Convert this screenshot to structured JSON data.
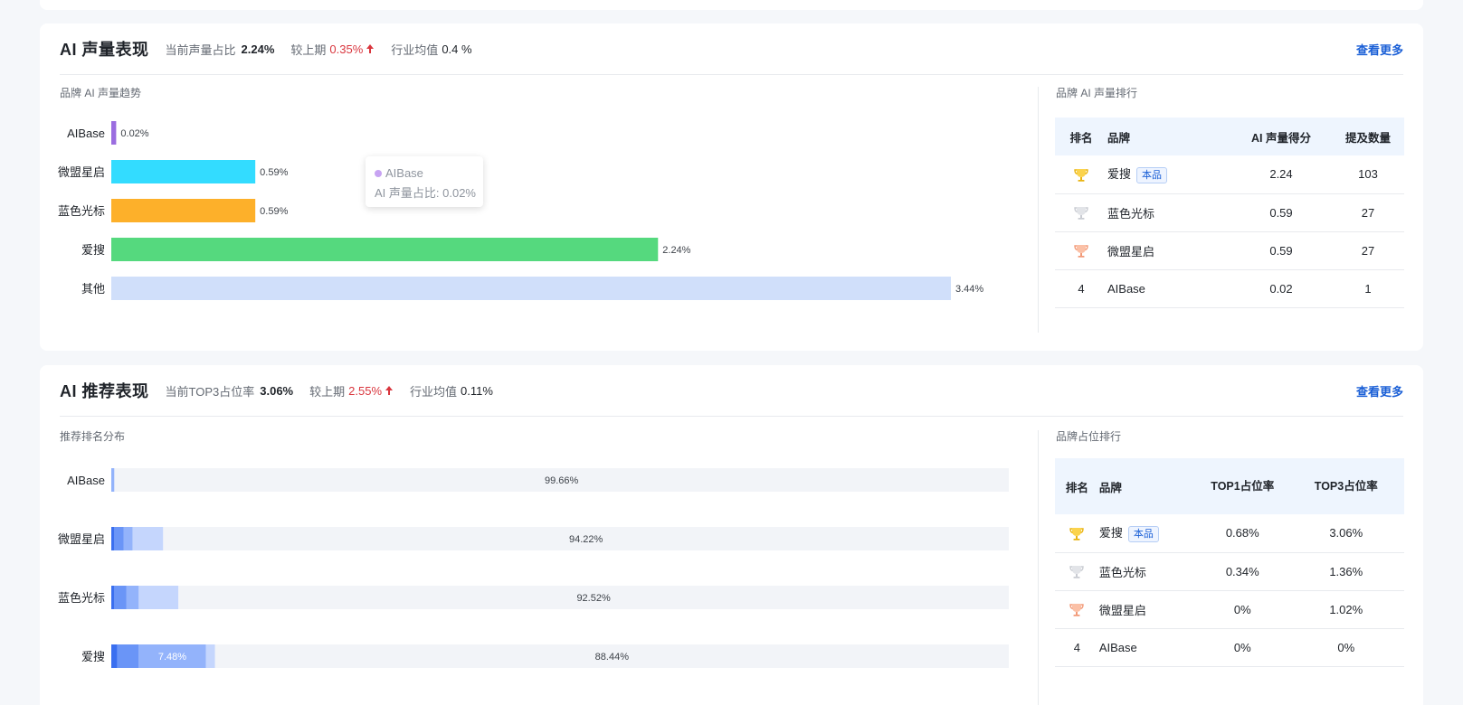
{
  "voice": {
    "title": "AI 声量表现",
    "metric1_label": "当前声量占比",
    "metric1_value": "2.24%",
    "metric2_label": "较上期",
    "metric2_value": "0.35%",
    "metric3_label": "行业均值",
    "metric3_value": "0.4 %",
    "more": "查看更多",
    "trend_label": "品牌 AI 声量趋势",
    "rank_label": "品牌 AI 声量排行",
    "tooltip_name": "AIBase",
    "tooltip_value": "AI 声量占比: 0.02%",
    "table": {
      "headers": [
        "排名",
        "品牌",
        "AI 声量得分",
        "提及数量"
      ],
      "rows": [
        {
          "rank": "trophy-gold",
          "brand": "爱搜",
          "tag": "本品",
          "score": "2.24",
          "count": "103"
        },
        {
          "rank": "trophy-silver",
          "brand": "蓝色光标",
          "tag": "",
          "score": "0.59",
          "count": "27"
        },
        {
          "rank": "trophy-bronze",
          "brand": "微盟星启",
          "tag": "",
          "score": "0.59",
          "count": "27"
        },
        {
          "rank": "4",
          "brand": "AIBase",
          "tag": "",
          "score": "0.02",
          "count": "1"
        }
      ]
    }
  },
  "recommend": {
    "title": "AI 推荐表现",
    "metric1_label": "当前TOP3占位率",
    "metric1_value": "3.06%",
    "metric2_label": "较上期",
    "metric2_value": "2.55%",
    "metric3_label": "行业均值",
    "metric3_value": "0.11%",
    "more": "查看更多",
    "dist_label": "推荐排名分布",
    "rank_label": "品牌占位排行",
    "table": {
      "headers": [
        "排名",
        "品牌",
        "TOP1占位率",
        "TOP3占位率"
      ],
      "rows": [
        {
          "rank": "trophy-gold",
          "brand": "爱搜",
          "tag": "本品",
          "top1": "0.68%",
          "top3": "3.06%"
        },
        {
          "rank": "trophy-silver",
          "brand": "蓝色光标",
          "tag": "",
          "top1": "0.34%",
          "top3": "1.36%"
        },
        {
          "rank": "trophy-bronze",
          "brand": "微盟星启",
          "tag": "",
          "top1": "0%",
          "top3": "1.02%"
        },
        {
          "rank": "4",
          "brand": "AIBase",
          "tag": "",
          "top1": "0%",
          "top3": "0%"
        }
      ]
    }
  },
  "chart_data": [
    {
      "type": "bar",
      "orientation": "horizontal",
      "categories": [
        "AIBase",
        "微盟星启",
        "蓝色光标",
        "爱搜",
        "其他"
      ],
      "values": [
        0.02,
        0.59,
        0.59,
        2.24,
        3.44
      ],
      "value_labels": [
        "0.02%",
        "0.59%",
        "0.59%",
        "2.24%",
        "3.44%"
      ],
      "colors": [
        "#9b6de0",
        "#33dcff",
        "#fdb02a",
        "#55d97e",
        "#d0dffa"
      ],
      "xlim": [
        0,
        3.44
      ]
    },
    {
      "type": "bar",
      "orientation": "horizontal",
      "stacked": true,
      "categories": [
        "AIBase",
        "微盟星启",
        "蓝色光标",
        "爱搜"
      ],
      "series": [
        {
          "values": [
            0,
            0.34,
            0.34,
            0.68
          ],
          "color": "#3a6ff0"
        },
        {
          "values": [
            0,
            1.02,
            1.36,
            2.38
          ],
          "color": "#6a95f7"
        },
        {
          "values": [
            0.34,
            1.02,
            1.36,
            7.48
          ],
          "color": "#93b3fb"
        },
        {
          "values": [
            0,
            3.4,
            4.42,
            1.02
          ],
          "color": "#c5d6fd"
        },
        {
          "values": [
            99.66,
            94.22,
            92.52,
            88.44
          ],
          "color": "#f2f4f8"
        }
      ],
      "segment_labels": [
        {
          "category": "爱搜",
          "series": 2,
          "text": "7.48%"
        },
        {
          "category": "AIBase",
          "series": 4,
          "text": "99.66%"
        },
        {
          "category": "微盟星启",
          "series": 4,
          "text": "94.22%"
        },
        {
          "category": "蓝色光标",
          "series": 4,
          "text": "92.52%"
        },
        {
          "category": "爱搜",
          "series": 4,
          "text": "88.44%"
        }
      ],
      "xlim": [
        0,
        100
      ]
    }
  ]
}
